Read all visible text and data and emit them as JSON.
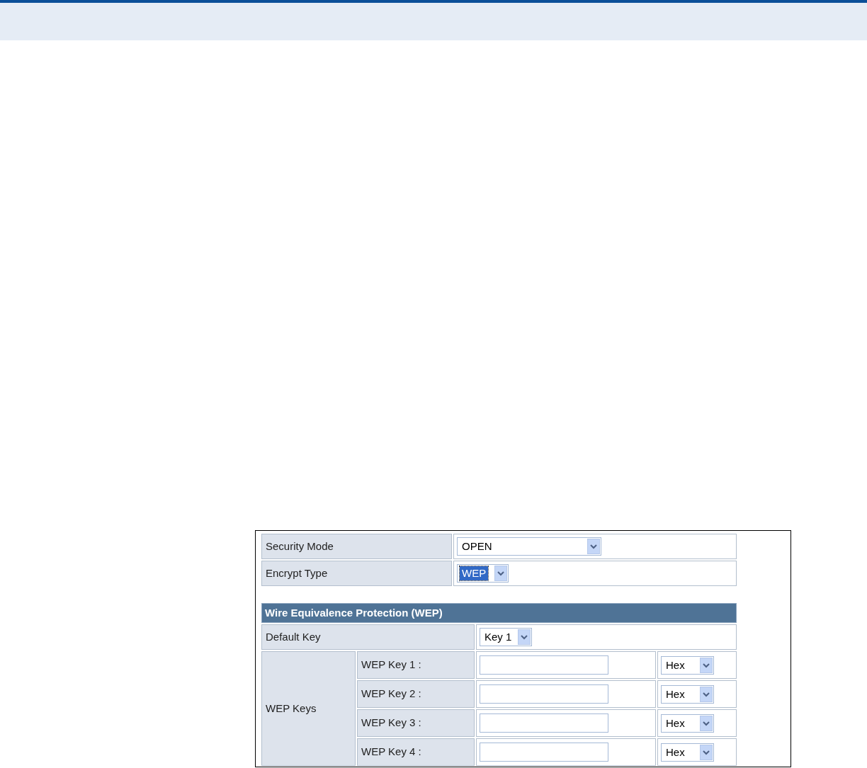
{
  "security_mode": {
    "label": "Security Mode",
    "value": "OPEN"
  },
  "encrypt_type": {
    "label": "Encrypt Type",
    "value": "WEP",
    "focused": true
  },
  "wep": {
    "title": "Wire Equivalence Protection (WEP)",
    "default_key": {
      "label": "Default Key",
      "value": "Key 1"
    },
    "keys_label": "WEP Keys",
    "keys": [
      {
        "label": "WEP Key 1 :",
        "format": "Hex"
      },
      {
        "label": "WEP Key 2 :",
        "format": "Hex"
      },
      {
        "label": "WEP Key 3 :",
        "format": "Hex"
      },
      {
        "label": "WEP Key 4 :",
        "format": "Hex"
      }
    ]
  }
}
